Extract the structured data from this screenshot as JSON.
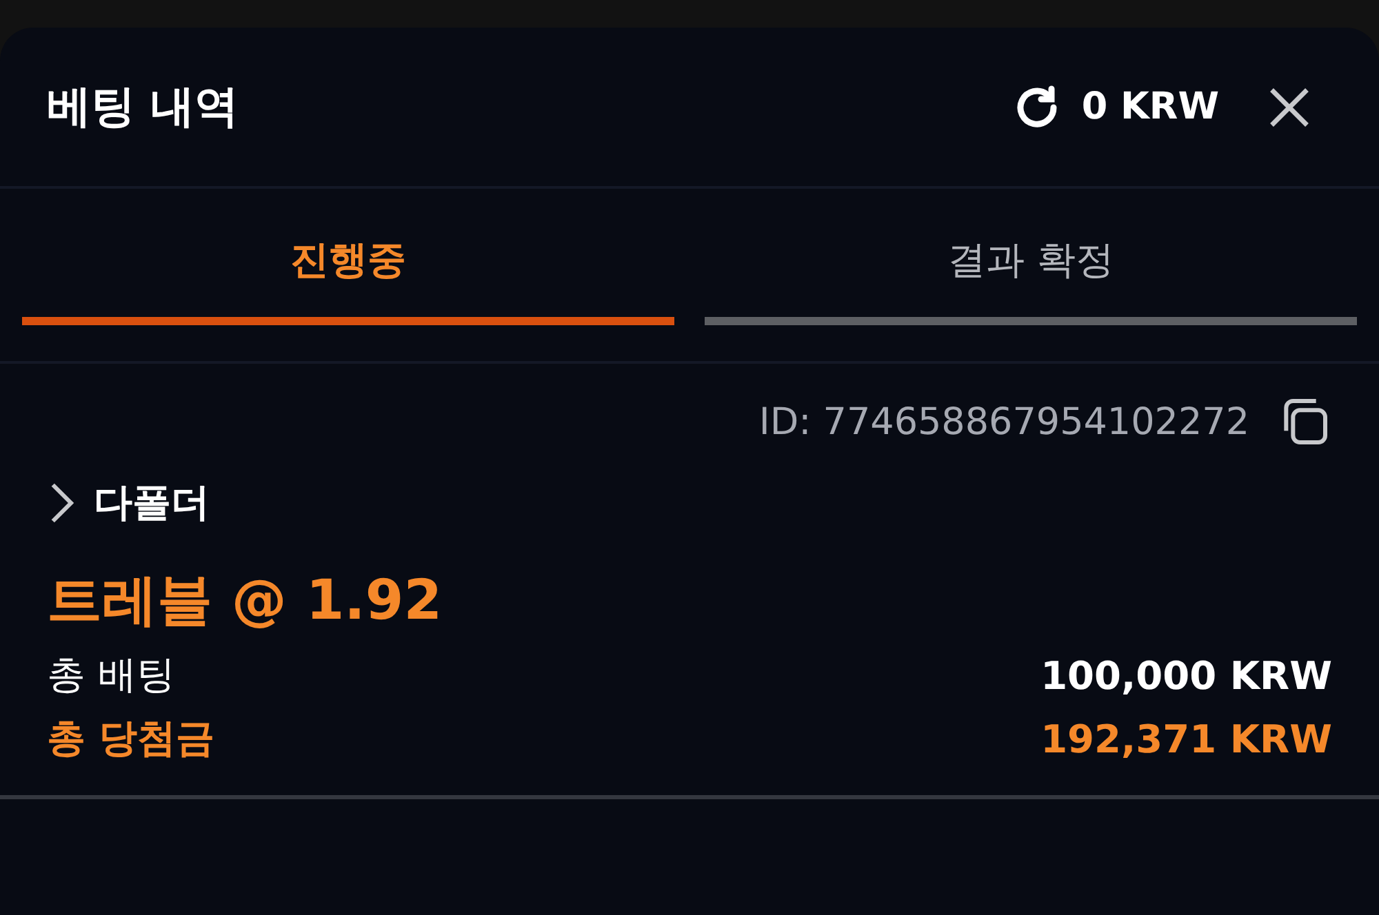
{
  "header": {
    "title": "베팅 내역",
    "balance": "0 KRW"
  },
  "tabs": [
    {
      "label": "진행중",
      "selected": true
    },
    {
      "label": "결과 확정",
      "selected": false
    }
  ],
  "bet": {
    "id": "ID: 774658867954102272",
    "group": {
      "label": "다폴더",
      "expanded": false
    },
    "selection": "트레블 @ 1.92",
    "rows": [
      {
        "label": "총 배팅",
        "value": "100,000 KRW",
        "highlighted": false
      },
      {
        "label": "총 당첨금",
        "value": "192,371 KRW",
        "highlighted": true
      }
    ]
  }
}
